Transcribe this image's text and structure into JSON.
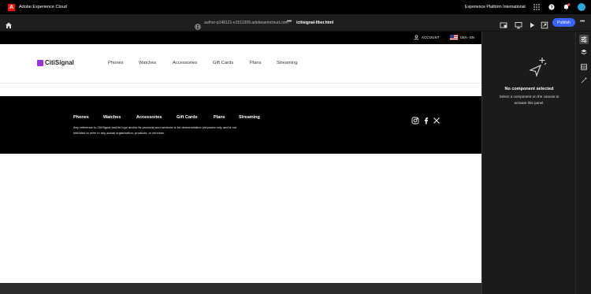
{
  "topbar": {
    "app_title": "Adobe Experience Cloud",
    "org_name": "Experience Platform International",
    "notification_count": "7"
  },
  "toolbar": {
    "url": "author-p148121-e1511399.adobeaemcloud.com",
    "more": "•••",
    "page_path": "/citisignal-fiber.html",
    "publish_label": "Publish",
    "tool_more": "•••"
  },
  "site": {
    "utility": {
      "account_label": "ACCOUNT",
      "locale_label": "USA - EN"
    },
    "brand": "CitiSignal",
    "nav": [
      "Phones",
      "Watches",
      "Accessories",
      "Gift Cards",
      "Plans",
      "Streaming"
    ],
    "footer": {
      "links": [
        "Phones",
        "Watches",
        "Accessories",
        "Gift Cards",
        "Plans",
        "Streaming"
      ],
      "disclaimer": "Any reference to CitiSignal and its logo and/or its products and services is for demonstration purposes only and is not intended to refer to any actual organization, products, or services."
    }
  },
  "properties_panel": {
    "title": "No component selected",
    "description": "Select a component on the canvas to activate this panel."
  },
  "colors": {
    "adobe_red": "#fa0f00",
    "publish_blue": "#3b63fb",
    "brand_purple": "#7c3aed"
  }
}
